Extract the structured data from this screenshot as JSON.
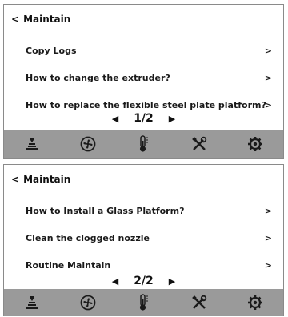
{
  "screens": [
    {
      "back_label": "<",
      "title": "Maintain",
      "items": [
        {
          "label": "Copy Logs",
          "chevron": ">"
        },
        {
          "label": "How to change the extruder?",
          "chevron": ">"
        },
        {
          "label": "How to replace the flexible steel plate platform?",
          "chevron": ">"
        }
      ],
      "pager": {
        "prev": "◀",
        "page": "1/2",
        "next": "▶"
      }
    },
    {
      "back_label": "<",
      "title": "Maintain",
      "items": [
        {
          "label": "How to Install a Glass Platform?",
          "chevron": ">"
        },
        {
          "label": "Clean the clogged nozzle",
          "chevron": ">"
        },
        {
          "label": "Routine Maintain",
          "chevron": ">"
        }
      ],
      "pager": {
        "prev": "◀",
        "page": "2/2",
        "next": "▶"
      }
    }
  ],
  "toolbar_icons": [
    "print-icon",
    "fan-icon",
    "thermometer-icon",
    "tools-icon",
    "settings-gear-icon"
  ],
  "colors": {
    "toolbar_bg": "#9a9a9a",
    "icon": "#1a1a1a",
    "border": "#8a8a8a"
  }
}
